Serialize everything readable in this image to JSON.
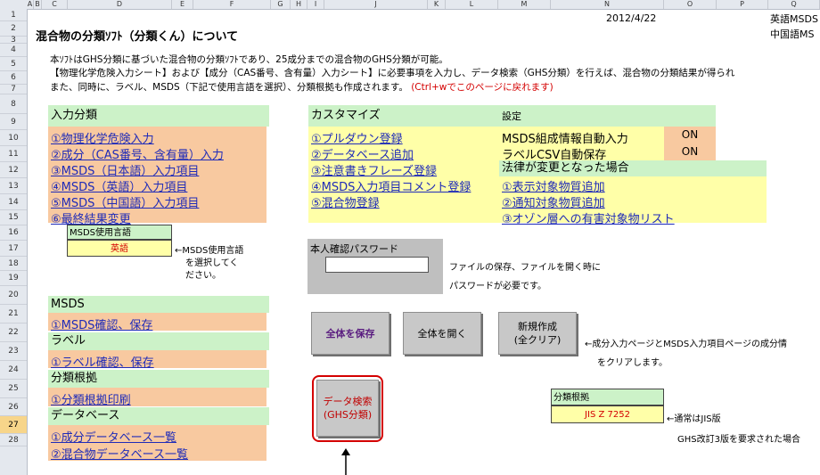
{
  "column_headers": [
    "A",
    "B",
    "C",
    "D",
    "E",
    "F",
    "G",
    "H",
    "I",
    "J",
    "K",
    "L",
    "M",
    "N",
    "O",
    "P",
    "Q"
  ],
  "row_numbers": [
    "1",
    "2",
    "3",
    "4",
    "5",
    "6",
    "7",
    "8",
    "9",
    "10",
    "11",
    "12",
    "13",
    "14",
    "15",
    "16",
    "17",
    "18",
    "19",
    "20",
    "21",
    "22",
    "23",
    "24",
    "25",
    "26",
    "27",
    "28"
  ],
  "selected_row": "27",
  "header": {
    "date": "2012/4/22",
    "lang_en": "英語MSDS",
    "lang_cn": "中国語MS",
    "title": "混合物の分類ｿﾌﾄ（分類くん）について"
  },
  "intro": {
    "line1": "本ｿﾌﾄはGHS分類に基づいた混合物の分類ｿﾌﾄであり、25成分までの混合物のGHS分類が可能。",
    "line2": "【物理化学危険入力シート】および【成分（CAS番号、含有量）入力シート】に必要事項を入力し、データ検索（GHS分類）を行えば、混合物の分類結果が得られ",
    "line3": "また、同時に、ラベル、MSDS（下記で使用言語を選択）、分類根拠も作成されます。",
    "line3_red": "(Ctrl+wでこのページに戻れます)"
  },
  "input_section": {
    "title": "入力分類",
    "links": [
      "①物理化学危険入力",
      "②成分（CAS番号、含有量）入力",
      "③MSDS（日本語）入力項目",
      "④MSDS（英語）入力項目",
      "⑤MSDS（中国語）入力項目",
      "⑥最終結果変更"
    ]
  },
  "msds_language": {
    "label": "MSDS使用言語",
    "value": "英語",
    "note1": "←MSDS使用言語",
    "note2": "を選択してく",
    "note3": "ださい。"
  },
  "customize": {
    "title": "カスタマイズ",
    "links": [
      "①プルダウン登録",
      "②データベース追加",
      "③注意書きフレーズ登録",
      "④MSDS入力項目コメント登録",
      "⑤混合物登録"
    ]
  },
  "settings": {
    "title": "設定",
    "row1_label": "MSDS組成情報自動入力",
    "row1_value": "ON",
    "row2_label": "ラベルCSV自動保存",
    "row2_value": "ON",
    "law_title": "法律が変更となった場合",
    "law_links": [
      "①表示対象物質追加",
      "②通知対象物質追加",
      "③オゾン層への有害対象物リスト"
    ]
  },
  "password": {
    "label": "本人確認パスワード",
    "value": "",
    "note1": "ファイルの保存、ファイルを開く時に",
    "note2": "パスワードが必要です。"
  },
  "output_sections": [
    {
      "title": "MSDS",
      "links": [
        "①MSDS確認、保存"
      ]
    },
    {
      "title": "ラベル",
      "links": [
        "①ラベル確認、保存"
      ]
    },
    {
      "title": "分類根拠",
      "links": [
        "①分類根拠印刷"
      ]
    },
    {
      "title": "データベース",
      "links": [
        "①成分データベース一覧",
        "②混合物データベース一覧"
      ]
    }
  ],
  "buttons": {
    "save_all": "全体を保存",
    "open_all": "全体を開く",
    "new_line1": "新規作成",
    "new_line2": "(全クリア)",
    "search_line1": "データ検索",
    "search_line2": "(GHS分類)"
  },
  "new_note1": "←成分入力ページとMSDS入力項目ページの成分情",
  "new_note2": "をクリアします。",
  "basis": {
    "label": "分類根拠",
    "value": "JIS Z 7252",
    "note1": "←通常はJIS版",
    "note2": "GHS改訂3版を要求された場合"
  },
  "colors": {
    "green": "#ccf2c8",
    "orange": "#f8c9a0",
    "yellow": "#ffffa8",
    "link": "#1f2bb8",
    "red": "#d40000",
    "grid_header": "#e4e8ee"
  }
}
